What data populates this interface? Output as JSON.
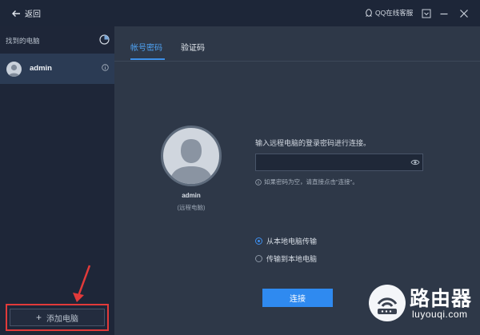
{
  "topbar": {
    "back_label": "返回",
    "support_label": "QQ在线客服"
  },
  "sidebar": {
    "found_label": "找到的电脑",
    "devices": [
      {
        "name": "admin"
      }
    ],
    "add_label": "添加电脑"
  },
  "tabs": [
    {
      "label": "帐号密码",
      "active": true
    },
    {
      "label": "验证码",
      "active": false
    }
  ],
  "profile": {
    "name": "admin",
    "subtitle": "(远程电脑)"
  },
  "form": {
    "prompt": "输入远程电脑的登录密码进行连接。",
    "password_value": "",
    "hint": "如果密码为空，请直接点击\"连接\"。",
    "options": [
      {
        "label": "从本地电脑传输",
        "selected": true
      },
      {
        "label": "传输到本地电脑",
        "selected": false
      }
    ],
    "connect_label": "连接"
  },
  "watermark": {
    "title": "路由器",
    "url": "luyouqi.com"
  },
  "colors": {
    "accent": "#2f8af0",
    "sidebar": "#1e2638",
    "main": "#2e3848",
    "highlight_box": "#e23a3a"
  }
}
